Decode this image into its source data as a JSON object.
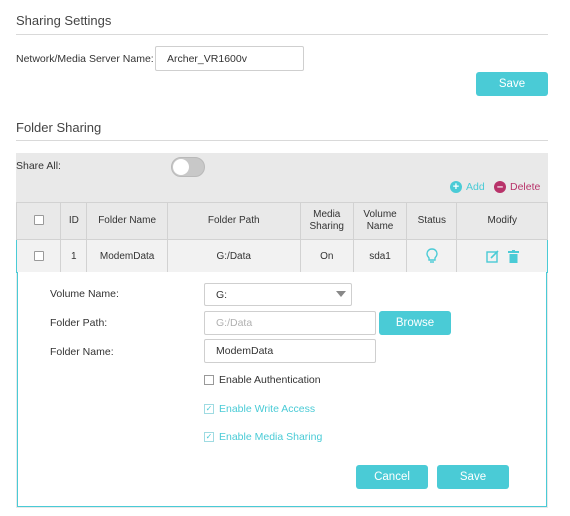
{
  "sharing_settings": {
    "title": "Sharing Settings",
    "server_name_label": "Network/Media Server Name:",
    "server_name_value": "Archer_VR1600v",
    "save_label": "Save"
  },
  "folder_sharing": {
    "title": "Folder Sharing",
    "share_all_label": "Share All:",
    "share_all_on": false,
    "add_label": "Add",
    "delete_label": "Delete",
    "columns": [
      "ID",
      "Folder Name",
      "Folder Path",
      "Media Sharing",
      "Volume Name",
      "Status",
      "Modify"
    ],
    "rows": [
      {
        "id": "1",
        "folder_name": "ModemData",
        "folder_path": "G:/Data",
        "media_sharing": "On",
        "volume_name": "sda1",
        "status_icon": "bulb-icon"
      }
    ]
  },
  "edit_form": {
    "volume_name_label": "Volume Name:",
    "volume_name_value": "G:",
    "folder_path_label": "Folder Path:",
    "folder_path_value": "G:/Data",
    "browse_label": "Browse",
    "folder_name_label": "Folder Name:",
    "folder_name_value": "ModemData",
    "enable_auth_label": "Enable Authentication",
    "enable_auth_checked": false,
    "enable_write_label": "Enable Write Access",
    "enable_write_checked": true,
    "enable_media_label": "Enable Media Sharing",
    "enable_media_checked": true,
    "cancel_label": "Cancel",
    "save_label": "Save"
  },
  "colors": {
    "accent": "#4acbd6",
    "delete": "#b8336a"
  }
}
